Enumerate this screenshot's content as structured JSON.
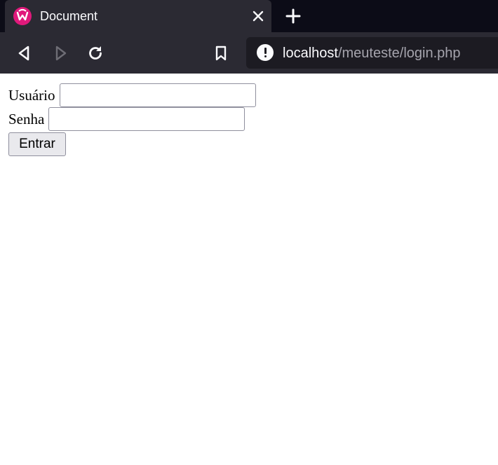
{
  "browser": {
    "tab": {
      "title": "Document",
      "favicon": "wamp-favicon-icon"
    },
    "url": {
      "host": "localhost",
      "path": "/meuteste/login.php"
    },
    "icons": {
      "back": "back-arrow-icon",
      "forward": "forward-arrow-icon",
      "reload": "reload-icon",
      "bookmark": "bookmark-icon",
      "security": "insecure-warning-icon",
      "close": "close-icon",
      "new_tab": "plus-icon"
    },
    "colors": {
      "tabstrip": "#0c0c17",
      "toolbar": "#2b2a33",
      "urlbar": "#1c1b22",
      "favicon": "#e0197b"
    }
  },
  "form": {
    "user_label": "Usuário",
    "user_value": "",
    "password_label": "Senha",
    "password_value": "",
    "submit_label": "Entrar"
  }
}
